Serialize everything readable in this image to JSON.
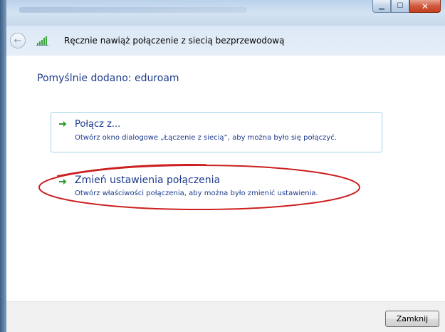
{
  "window": {
    "title_text": "Ręcznie nawiąż połączenie z siecią bezprzewodową",
    "caption_min": "▁",
    "caption_max": "☐",
    "caption_close": "✕"
  },
  "content": {
    "heading": "Pomyślnie dodano: eduroam",
    "options": [
      {
        "title": "Połącz z...",
        "description": "Otwórz okno dialogowe „Łączenie z siecią”, aby można było się połączyć."
      },
      {
        "title": "Zmień ustawienia połączenia",
        "description": "Otwórz właściwości połączenia, aby można było zmienić ustawienia."
      }
    ]
  },
  "footer": {
    "close_label": "Zamknij"
  },
  "icons": {
    "back": "back-arrow-icon",
    "network": "wireless-signal-icon",
    "option_arrow": "green-arrow-icon"
  },
  "colors": {
    "link_blue": "#1e3b8c",
    "arrow_green": "#2e9d2e",
    "annotation_red": "#cc1f1f",
    "selection_border": "#9ed4ea"
  }
}
